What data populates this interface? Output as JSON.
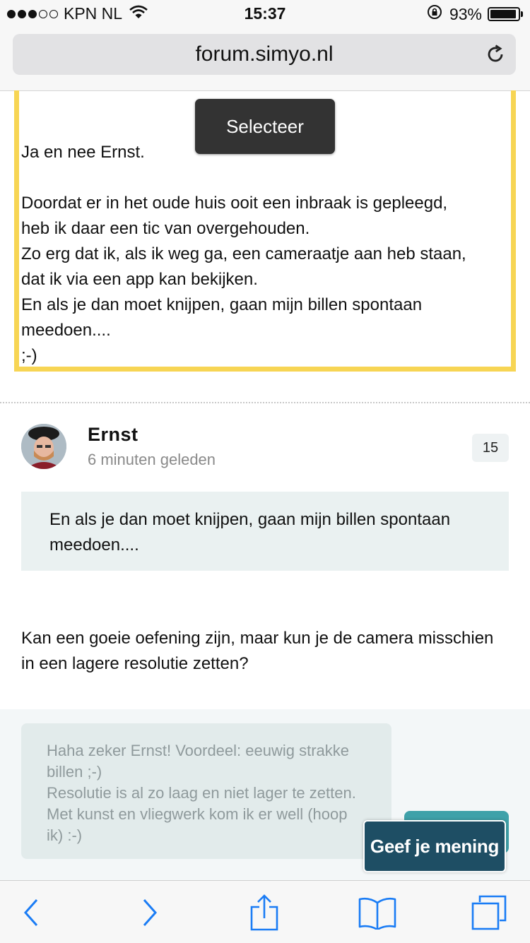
{
  "status_bar": {
    "carrier": "KPN NL",
    "time": "15:37",
    "battery": "93%",
    "signal_bars_filled": 3,
    "signal_bars_total": 5
  },
  "browser": {
    "url": "forum.simyo.nl"
  },
  "quoted_post": {
    "selection_popup": "Selecteer",
    "greeting": "Ja en nee Ernst.",
    "body": "Doordat er in het oude huis ooit een inbraak is gepleegd,\nheb ik daar een tic van overgehouden.\nZo erg dat ik, als ik weg ga, een cameraatje aan heb staan,\ndat ik via een app kan bekijken.\nEn als je dan moet knijpen, gaan mijn billen spontaan\nmeedoen....\n;-)"
  },
  "reply": {
    "author": "Ernst",
    "time_ago": "6 minuten geleden",
    "badge_count": "15",
    "inline_quote": "En als je dan moet knijpen, gaan mijn billen spontaan meedoen....",
    "text": "Kan een goeie oefening zijn, maar kun je de camera misschien in een lagere resolutie zetten?"
  },
  "compose": {
    "draft_text": "Haha zeker Ernst! Voordeel: eeuwig strakke billen ;-)\nResolutie is al zo laag en niet lager te zetten. Met kunst en vliegwerk kom ik er well (hoop ik) :-)",
    "feedback_tab_label": "Geef je mening"
  },
  "colors": {
    "highlight_border": "#f7d554",
    "ios_blue": "#1a7cf5",
    "feedback_tab": "#1e4e64",
    "teal_button": "#3ea1a9"
  },
  "toolbar": {
    "icons": [
      "back-icon",
      "forward-icon",
      "share-icon",
      "bookmarks-icon",
      "tabs-icon"
    ]
  }
}
